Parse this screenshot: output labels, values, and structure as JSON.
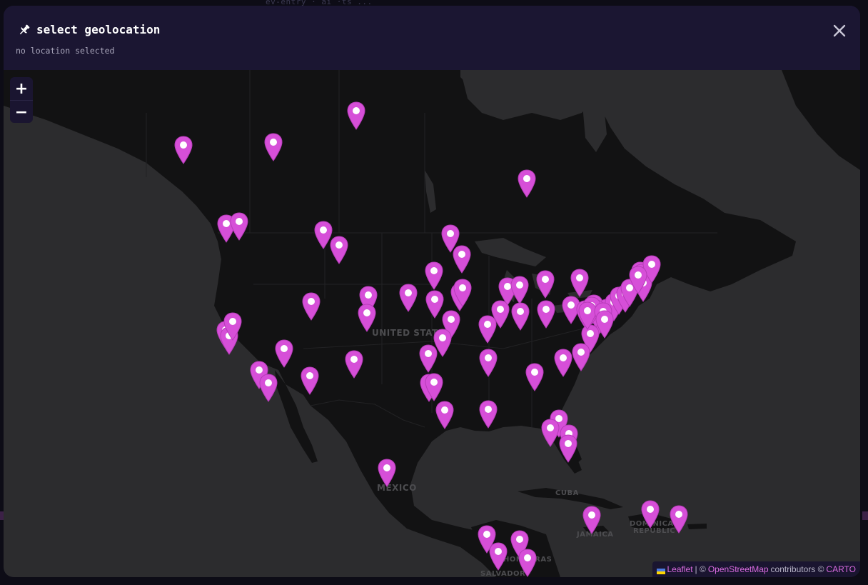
{
  "backdrop": {
    "text": "ev-entry · ai ·ts ..."
  },
  "dialog": {
    "title": "select geolocation",
    "subtitle": "no location selected",
    "icons": {
      "title_icon": "pin-icon",
      "close_icon": "close-icon"
    }
  },
  "map": {
    "zoom": {
      "in_label": "+",
      "out_label": "−"
    },
    "labels": {
      "united_states": "UNITED STATES",
      "mexico": "MEXICO",
      "cuba": "CUBA",
      "jamaica": "JAMAICA",
      "dominican_republic_1": "DOMINICAN",
      "dominican_republic_2": "REPUBLIC",
      "honduras": "HONDURAS",
      "el_salvador": "SALVADOR"
    },
    "marker_color": "#d64fd8",
    "marker_count": 92,
    "attribution": {
      "leaflet": "Leaflet",
      "separator": "| ©",
      "osm": "OpenStreetMap",
      "contributors": "contributors ©",
      "carto": "CARTO"
    }
  },
  "colors": {
    "land": "#121213",
    "water": "#2c2c2e",
    "modal": "#1a1530",
    "accent": "#d96be0"
  }
}
